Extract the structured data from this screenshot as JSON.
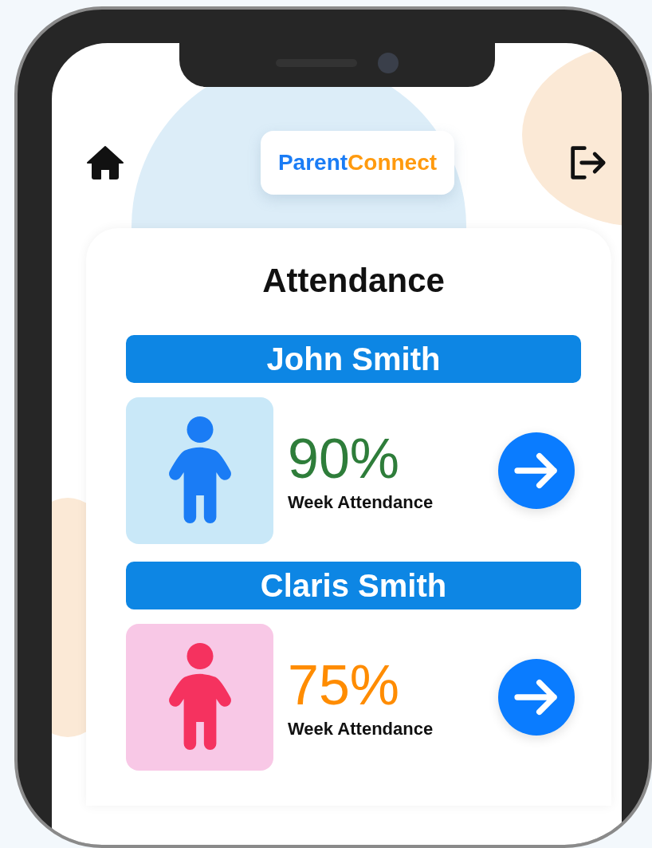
{
  "header": {
    "logo": [
      {
        "text": "Parent",
        "color": "#1a7cf5"
      },
      {
        "text": "Connect",
        "color": "#ff9a0e"
      }
    ]
  },
  "card": {
    "title": "Attendance",
    "students": [
      {
        "name": "John Smith",
        "kind": "boy",
        "percent": "90%",
        "color": "#2e7d3a",
        "label": "Week Attendance"
      },
      {
        "name": "Claris Smith",
        "kind": "girl",
        "percent": "75%",
        "color": "#ff8c00",
        "label": "Week Attendance"
      }
    ]
  }
}
